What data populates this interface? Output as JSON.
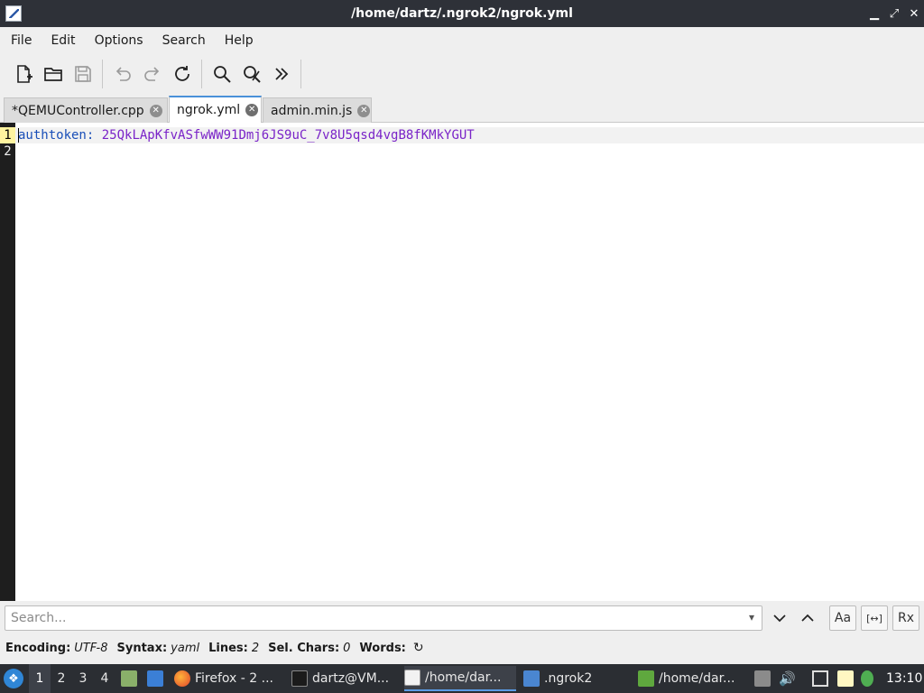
{
  "window": {
    "title": "/home/dartz/.ngrok2/ngrok.yml",
    "controls": {
      "minimize": "▁",
      "maximize": "⤢",
      "close": "✕"
    }
  },
  "menu": [
    "File",
    "Edit",
    "Options",
    "Search",
    "Help"
  ],
  "toolbar": {
    "icons": [
      "new-file-icon",
      "open-file-icon",
      "save-icon",
      "undo-icon",
      "redo-icon",
      "reload-icon",
      "find-icon",
      "find-replace-icon",
      "more-icon"
    ]
  },
  "tabs": [
    {
      "label": "*QEMUController.cpp",
      "active": false
    },
    {
      "label": "ngrok.yml",
      "active": true
    },
    {
      "label": "admin.min.js",
      "active": false
    }
  ],
  "editor": {
    "line_numbers": [
      "1",
      "2"
    ],
    "lines": [
      {
        "key": "authtoken:",
        "value": " 25QkLApKfvASfwWW91Dmj6JS9uC_7v8U5qsd4vgB8fKMkYGUT"
      }
    ]
  },
  "search": {
    "placeholder": "Search...",
    "buttons": {
      "down": "⌄",
      "up": "⌃",
      "match_case": "Aa",
      "whole_word": "[↔]",
      "regex": "Rx"
    }
  },
  "status": {
    "encoding_label": "Encoding:",
    "encoding_value": "UTF-8",
    "syntax_label": "Syntax:",
    "syntax_value": "yaml",
    "lines_label": "Lines:",
    "lines_value": "2",
    "selchars_label": "Sel. Chars:",
    "selchars_value": "0",
    "words_label": "Words:",
    "words_icon": "↻"
  },
  "taskbar": {
    "workspaces": [
      "1",
      "2",
      "3",
      "4"
    ],
    "tasks": [
      "Firefox - 2 ...",
      "dartz@VM...",
      "/home/dar...",
      ".ngrok2",
      "/home/dar..."
    ],
    "clock": "13:10"
  }
}
